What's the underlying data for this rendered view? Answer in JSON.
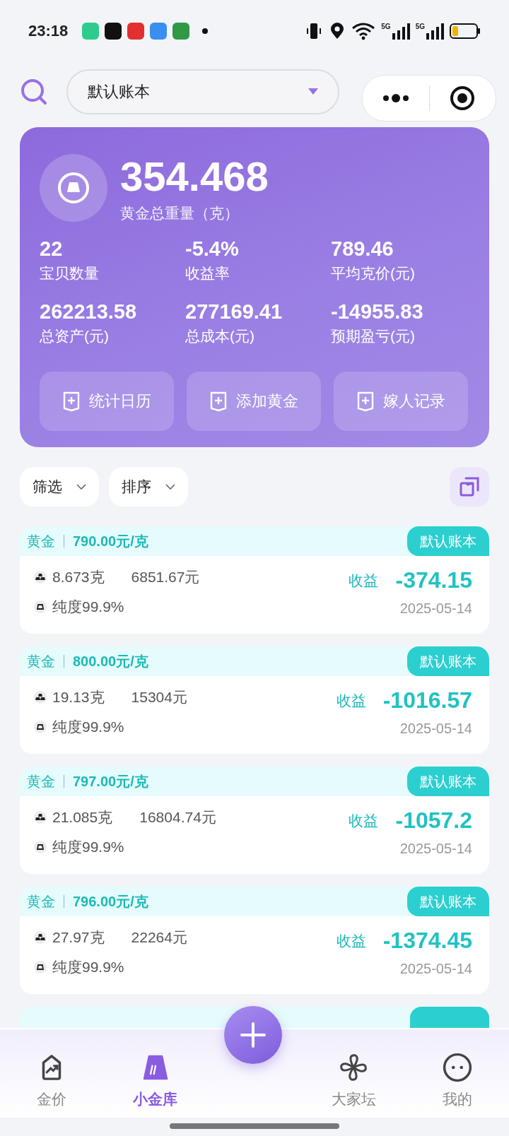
{
  "status_bar": {
    "time": "23:18",
    "networks": [
      "5G",
      "5G"
    ]
  },
  "header": {
    "book_selector": "默认账本"
  },
  "summary": {
    "total": "354.468",
    "total_label": "黄金总重量（克）",
    "stats": [
      {
        "value": "22",
        "label": "宝贝数量"
      },
      {
        "value": "-5.4%",
        "label": "收益率"
      },
      {
        "value": "789.46",
        "label": "平均克价(元)"
      },
      {
        "value": "262213.58",
        "label": "总资产(元)"
      },
      {
        "value": "277169.41",
        "label": "总成本(元)"
      },
      {
        "value": "-14955.83",
        "label": "预期盈亏(元)"
      }
    ],
    "actions": [
      "统计日历",
      "添加黄金",
      "嫁人记录"
    ]
  },
  "filters": [
    "筛选",
    "排序"
  ],
  "items": [
    {
      "type": "黄金",
      "price": "790.00元/克",
      "book": "默认账本",
      "weight": "8.673克",
      "amount": "6851.67元",
      "purity": "纯度99.9%",
      "profit_label": "收益",
      "profit": "-374.15",
      "date": "2025-05-14"
    },
    {
      "type": "黄金",
      "price": "800.00元/克",
      "book": "默认账本",
      "weight": "19.13克",
      "amount": "15304元",
      "purity": "纯度99.9%",
      "profit_label": "收益",
      "profit": "-1016.57",
      "date": "2025-05-14"
    },
    {
      "type": "黄金",
      "price": "797.00元/克",
      "book": "默认账本",
      "weight": "21.085克",
      "amount": "16804.74元",
      "purity": "纯度99.9%",
      "profit_label": "收益",
      "profit": "-1057.2",
      "date": "2025-05-14"
    },
    {
      "type": "黄金",
      "price": "796.00元/克",
      "book": "默认账本",
      "weight": "27.97克",
      "amount": "22264元",
      "purity": "纯度99.9%",
      "profit_label": "收益",
      "profit": "-1374.45",
      "date": "2025-05-14"
    }
  ],
  "nav": [
    {
      "label": "金价",
      "selected": false
    },
    {
      "label": "小金库",
      "selected": true
    },
    {
      "label": "大家坛",
      "selected": false
    },
    {
      "label": "我的",
      "selected": false
    }
  ]
}
